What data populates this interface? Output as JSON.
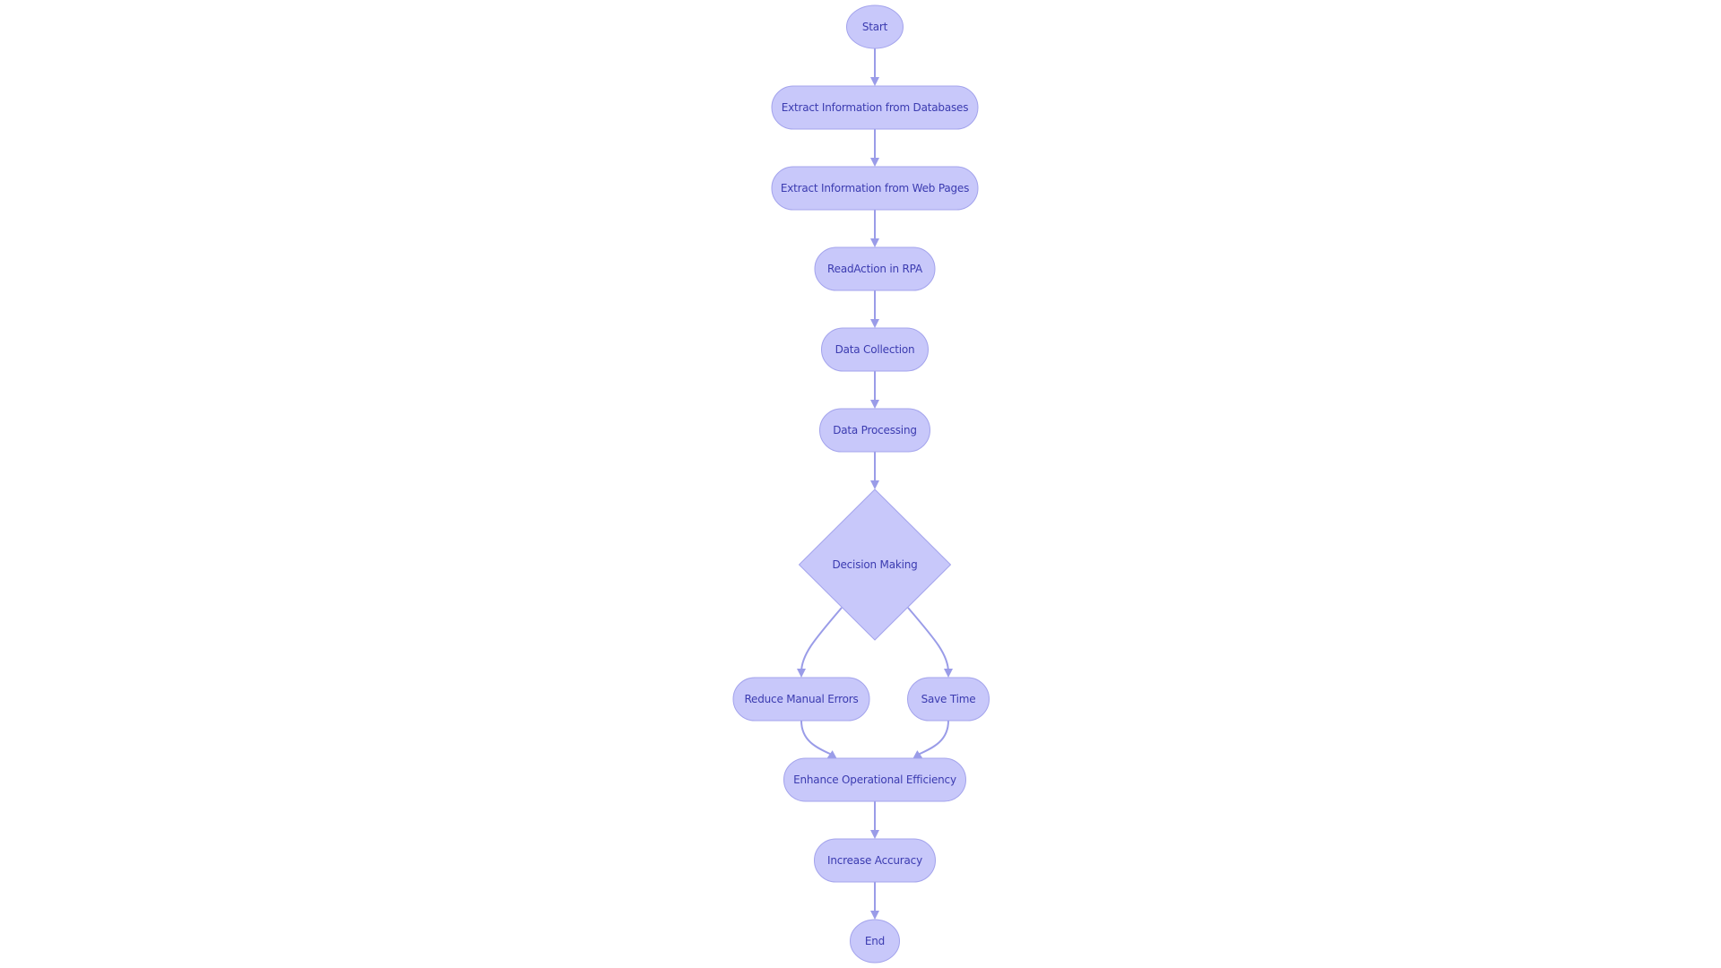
{
  "diagram": {
    "type": "flowchart",
    "direction": "top-down",
    "colors": {
      "node_fill": "#c8c8fa",
      "node_stroke": "#a3a3ec",
      "edge": "#9a9ce8",
      "text": "#3b3bb0",
      "background": "#ffffff"
    },
    "nodes": [
      {
        "id": "start",
        "label": "Start",
        "shape": "circle"
      },
      {
        "id": "extract_db",
        "label": "Extract Information from Databases",
        "shape": "stadium"
      },
      {
        "id": "extract_web",
        "label": "Extract Information from Web Pages",
        "shape": "stadium"
      },
      {
        "id": "readaction",
        "label": "ReadAction in RPA",
        "shape": "stadium"
      },
      {
        "id": "data_collection",
        "label": "Data Collection",
        "shape": "stadium"
      },
      {
        "id": "data_processing",
        "label": "Data Processing",
        "shape": "stadium"
      },
      {
        "id": "decision",
        "label": "Decision Making",
        "shape": "diamond"
      },
      {
        "id": "reduce_errors",
        "label": "Reduce Manual Errors",
        "shape": "stadium"
      },
      {
        "id": "save_time",
        "label": "Save Time",
        "shape": "stadium"
      },
      {
        "id": "enhance",
        "label": "Enhance Operational Efficiency",
        "shape": "stadium"
      },
      {
        "id": "accuracy",
        "label": "Increase Accuracy",
        "shape": "stadium"
      },
      {
        "id": "end",
        "label": "End",
        "shape": "circle"
      }
    ],
    "edges": [
      {
        "from": "start",
        "to": "extract_db"
      },
      {
        "from": "extract_db",
        "to": "extract_web"
      },
      {
        "from": "extract_web",
        "to": "readaction"
      },
      {
        "from": "readaction",
        "to": "data_collection"
      },
      {
        "from": "data_collection",
        "to": "data_processing"
      },
      {
        "from": "data_processing",
        "to": "decision"
      },
      {
        "from": "decision",
        "to": "reduce_errors"
      },
      {
        "from": "decision",
        "to": "save_time"
      },
      {
        "from": "reduce_errors",
        "to": "enhance"
      },
      {
        "from": "save_time",
        "to": "enhance"
      },
      {
        "from": "enhance",
        "to": "accuracy"
      },
      {
        "from": "accuracy",
        "to": "end"
      }
    ]
  }
}
